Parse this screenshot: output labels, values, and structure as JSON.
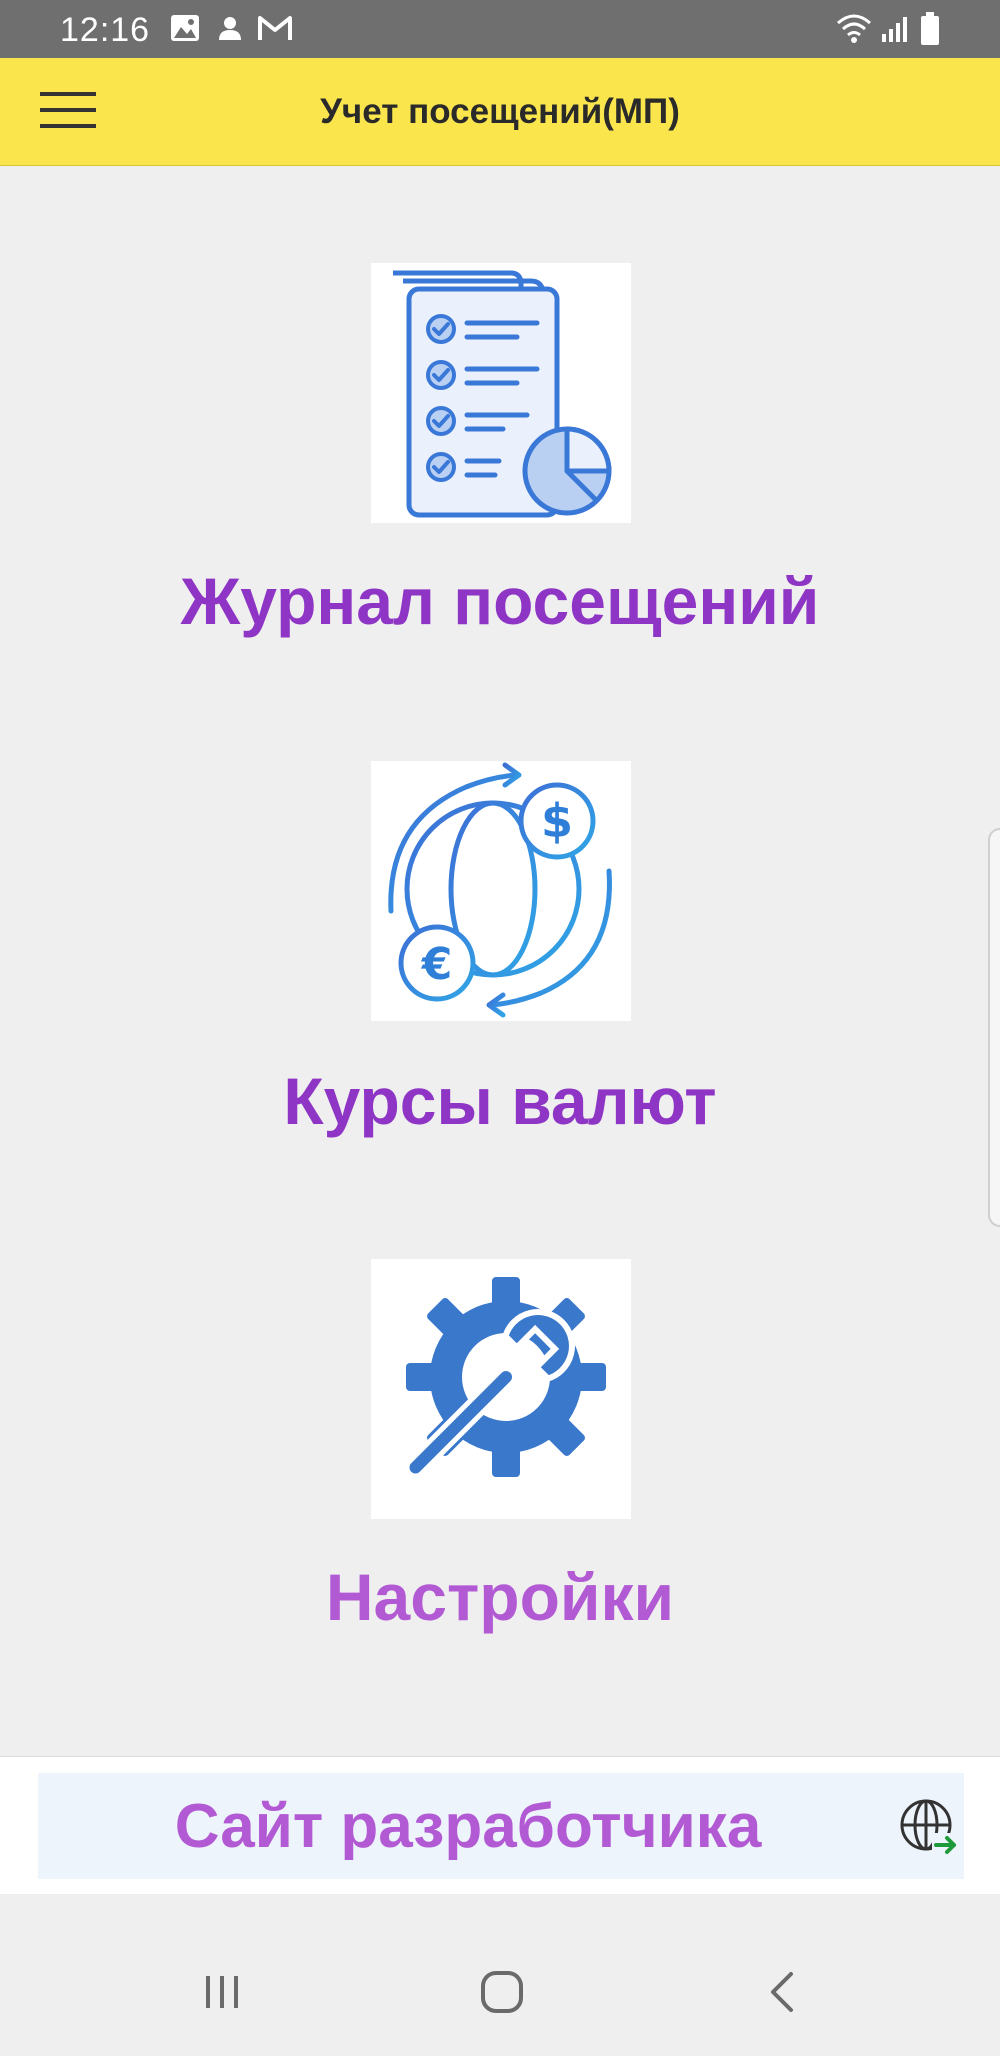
{
  "status_bar": {
    "time": "12:16",
    "left_icons": [
      "image-icon",
      "person-icon",
      "gmail-icon"
    ],
    "right_icons": [
      "wifi-icon",
      "signal-icon",
      "battery-icon"
    ]
  },
  "app_bar": {
    "title": "Учет посещений(МП)",
    "menu_icon": "hamburger-menu-icon"
  },
  "menu": {
    "items": [
      {
        "label": "Журнал посещений",
        "icon": "checklist-report-icon"
      },
      {
        "label": "Курсы валют",
        "icon": "currency-exchange-globe-icon"
      },
      {
        "label": "Настройки",
        "icon": "gear-wrench-icon"
      }
    ]
  },
  "footer": {
    "site_label": "Сайт разработчика",
    "site_icon": "globe-link-icon"
  },
  "nav_bar": {
    "buttons": [
      "recent-apps-icon",
      "home-icon",
      "back-icon"
    ]
  },
  "colors": {
    "app_bar": "#fbe54c",
    "label_primary": "#8e35c5",
    "label_light": "#b259d4",
    "icon_blue": "#3a78d8",
    "background": "#efefef"
  }
}
